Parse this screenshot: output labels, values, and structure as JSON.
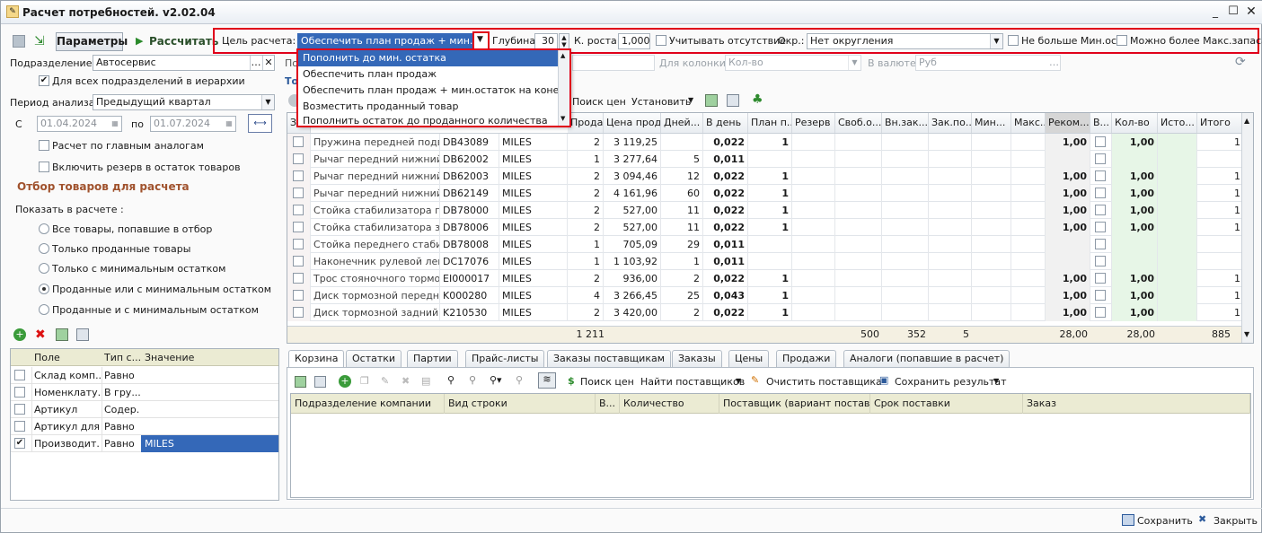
{
  "window": {
    "title": "Расчет потребностей. v2.02.04"
  },
  "toolbar": {
    "params_label": "Параметры",
    "calc_label": "Рассчитать",
    "goal_label": "Цель расчета:",
    "goal_value": "Обеспечить план продаж + мин.остат",
    "depth_label": "Глубина:",
    "depth_value": "30",
    "growth_label": "К. роста:",
    "growth_value": "1,000",
    "absence_label": "Учитывать отсутствие",
    "round_label": "Окр.:",
    "round_value": "Нет округления",
    "no_more_min_label": "Не больше Мин.ост",
    "max_stock_label": "Можно более Макс.запаса"
  },
  "goal_options": [
    "Пополнить до мин. остатка",
    "Обеспечить план продаж",
    "Обеспечить план продаж + мин.остаток на конец периода",
    "Возместить проданный товар",
    "Пополнить остаток до проданного количества"
  ],
  "left": {
    "dept_label": "Подразделение:",
    "dept_value": "Автосервис",
    "all_depts_label": "Для всех подразделений в иерархии",
    "period_label": "Период анализа:",
    "period_value": "Предыдущий квартал",
    "from_label": "С",
    "from_value": "01.04.2024",
    "to_label": "по",
    "to_value": "01.07.2024",
    "analogs_label": "Расчет по главным аналогам",
    "reserve_label": "Включить резерв в остаток товаров",
    "filter_title": "Отбор товаров для расчета",
    "show_label": "Показать в расчете :",
    "radios": [
      "Все товары, попавшие в отбор",
      "Только проданные товары",
      "Только с минимальным остатком",
      "Проданные или с минимальным остатком",
      "Проданные и с минимальным остатком"
    ],
    "filter_headers": [
      "Поле",
      "Тип с...",
      "Значение"
    ],
    "filters": [
      {
        "field": "Склад комп...",
        "type": "Равно",
        "value": "",
        "checked": false
      },
      {
        "field": "Номенклату...",
        "type": "В гру...",
        "value": "",
        "checked": false
      },
      {
        "field": "Артикул",
        "type": "Содер...",
        "value": "",
        "checked": false
      },
      {
        "field": "Артикул для...",
        "type": "Равно",
        "value": "",
        "checked": false
      },
      {
        "field": "Производит...",
        "type": "Равно",
        "value": "MILES",
        "checked": true
      }
    ]
  },
  "topbar": {
    "p_label": "По",
    "col_label": "Для колонки:",
    "col_value": "Кол-во",
    "cur_label": "В валюте:",
    "cur_value": "Руб",
    "to_label": "То",
    "search_prices": "Поиск цен",
    "set_label": "Установить"
  },
  "grid": {
    "headers": [
      "З...",
      "",
      "",
      "",
      "Прода...",
      "Цена прод...",
      "Дней...",
      "В день",
      "План п...",
      "Резерв",
      "Своб.о...",
      "Вн.зак...",
      "Зак.по...",
      "Мин...",
      "Макс...",
      "Реком...",
      "В...",
      "Кол-во",
      "Исто...",
      "Итого"
    ],
    "rows": [
      [
        "Пружина передней подв...",
        "DB43089",
        "MILES",
        "2",
        "3 119,25",
        "",
        "0,022",
        "1",
        "1,00",
        "1,00",
        "1"
      ],
      [
        "Рычаг передний нижний ...",
        "DB62002",
        "MILES",
        "1",
        "3 277,64",
        "5",
        "0,011",
        "",
        "",
        "",
        ""
      ],
      [
        "Рычаг передний нижний ...",
        "DB62003",
        "MILES",
        "2",
        "3 094,46",
        "12",
        "0,022",
        "1",
        "1,00",
        "1,00",
        "1"
      ],
      [
        "Рычаг передний нижний",
        "DB62149",
        "MILES",
        "2",
        "4 161,96",
        "60",
        "0,022",
        "1",
        "1,00",
        "1,00",
        "1"
      ],
      [
        "Стойка стабилизатора п...",
        "DB78000",
        "MILES",
        "2",
        "527,00",
        "11",
        "0,022",
        "1",
        "1,00",
        "1,00",
        "1"
      ],
      [
        "Стойка стабилизатора з...",
        "DB78006",
        "MILES",
        "2",
        "527,00",
        "11",
        "0,022",
        "1",
        "1,00",
        "1,00",
        "1"
      ],
      [
        "Стойка переднего стаби...",
        "DB78008",
        "MILES",
        "1",
        "705,09",
        "29",
        "0,011",
        "",
        "",
        "",
        ""
      ],
      [
        "Наконечник рулевой лев...",
        "DC17076",
        "MILES",
        "1",
        "1 103,92",
        "1",
        "0,011",
        "",
        "",
        "",
        ""
      ],
      [
        "Трос стояночного тормо...",
        "EI000017",
        "MILES",
        "2",
        "936,00",
        "2",
        "0,022",
        "1",
        "1,00",
        "1,00",
        "1"
      ],
      [
        "Диск тормозной передн...",
        "K000280",
        "MILES",
        "4",
        "3 266,45",
        "25",
        "0,043",
        "1",
        "1,00",
        "1,00",
        "1"
      ],
      [
        "Диск тормозной задний",
        "K210530",
        "MILES",
        "2",
        "3 420,00",
        "2",
        "0,022",
        "1",
        "1,00",
        "1,00",
        "1"
      ]
    ],
    "totals": {
      "qty": "1 211",
      "free": "500",
      "inner": "352",
      "ord": "5",
      "rec": "28,00",
      "count": "28,00",
      "total": "885"
    }
  },
  "tabs": [
    "Корзина",
    "Остатки",
    "Партии",
    "Прайс-листы",
    "Заказы поставщикам",
    "Заказы",
    "Цены",
    "Продажи",
    "Аналоги (попавшие в расчет)"
  ],
  "basket": {
    "search_prices": "Поиск цен",
    "find_suppliers": "Найти поставщиков",
    "clear_suppliers": "Очистить поставщика",
    "save_result": "Сохранить результат",
    "headers": [
      "Подразделение компании",
      "Вид строки",
      "В...",
      "Количество",
      "Поставщик (вариант поставки)",
      "Срок поставки",
      "Заказ"
    ]
  },
  "footer": {
    "save": "Сохранить",
    "close": "Закрыть"
  }
}
